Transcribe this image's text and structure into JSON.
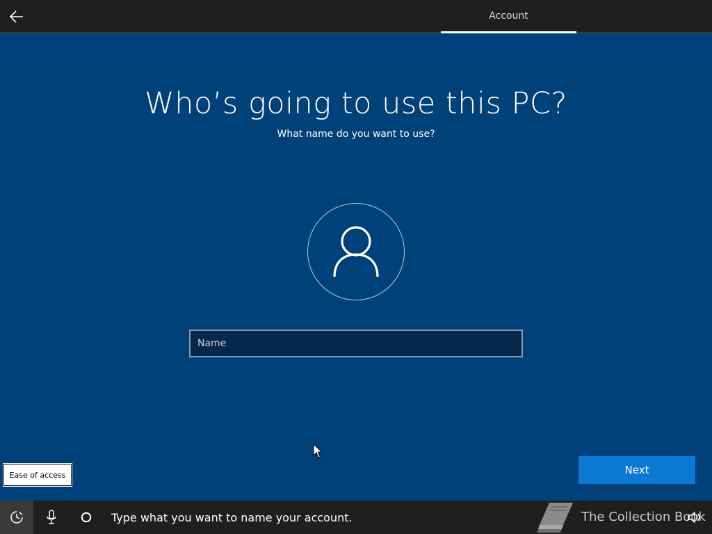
{
  "header": {
    "back_icon": "arrow-left-icon",
    "tab_label": "Account"
  },
  "main": {
    "title": "Who’s going to use this PC?",
    "subtitle": "What name do you want to use?",
    "avatar_icon": "user-icon",
    "name_input": {
      "value": "",
      "placeholder": "Name"
    }
  },
  "actions": {
    "ease_of_access_label": "Ease of access",
    "next_label": "Next"
  },
  "bottom_bar": {
    "ease_icon": "ease-of-access-icon",
    "mic_icon": "microphone-icon",
    "cortana_icon": "cortana-circle-icon",
    "prompt": "Type what you want to name your account.",
    "speaker_icon": "speaker-volume-icon"
  },
  "watermark": {
    "text": "The Collection Book",
    "icon": "book-icon"
  },
  "colors": {
    "background": "#014179",
    "top_bar": "#1f1f1f",
    "next_button": "#0b78d4",
    "input_background": "#03284c"
  }
}
